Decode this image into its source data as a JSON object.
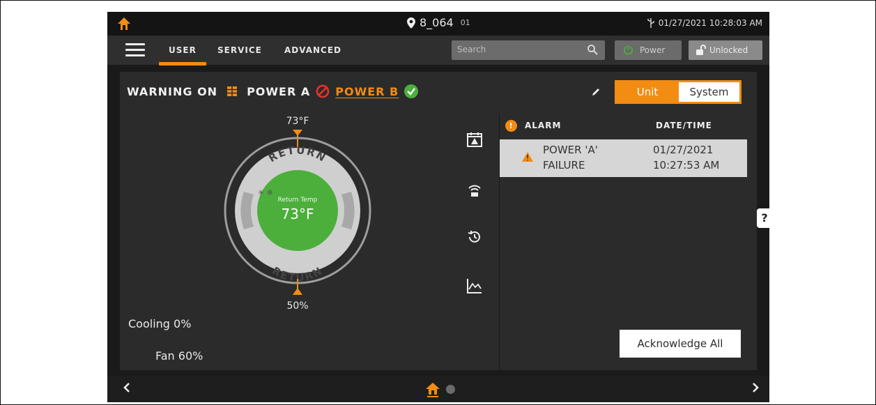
{
  "status": {
    "location": "8_064",
    "location_sub": "01",
    "datetime": "01/27/2021 10:28:03 AM"
  },
  "nav": {
    "tabs": [
      "USER",
      "SERVICE",
      "ADVANCED"
    ],
    "active_tab": "USER",
    "search_placeholder": "Search",
    "power_label": "Power",
    "lock_label": "Unlocked"
  },
  "status_line": {
    "warning_label": "WARNING ON",
    "power_a_label": "POWER A",
    "power_b_label": "POWER B"
  },
  "view_toggle": {
    "unit_label": "Unit",
    "system_label": "System",
    "selected": "Unit"
  },
  "gauge": {
    "setpoint_top": "73°F",
    "ring_top_label": "RETURN",
    "ring_bottom_label": "RETURN",
    "center_caption": "Return Temp",
    "center_value": "73°F",
    "setpoint_bottom": "50%"
  },
  "stats": {
    "cooling": "Cooling 0%",
    "fan": "Fan 60%"
  },
  "alarms": {
    "badge": "!",
    "header_alarm": "ALARM",
    "header_datetime": "DATE/TIME",
    "rows": [
      {
        "text_line1": "POWER 'A'",
        "text_line2": "FAILURE",
        "date": "01/27/2021",
        "time": "10:27:53 AM"
      }
    ],
    "acknowledge_label": "Acknowledge All"
  },
  "help_label": "?",
  "colors": {
    "accent": "#f28c13",
    "green": "#4caf3c",
    "panel": "#2b2b2b",
    "alert_red": "#e8332a"
  },
  "icons": [
    "home-icon",
    "location-pin-icon",
    "usb-icon",
    "menu-icon",
    "search-icon",
    "power-icon",
    "unlock-icon",
    "warning-grid-icon",
    "no-entry-icon",
    "check-icon",
    "edit-icon",
    "calendar-alarm-icon",
    "wireless-icon",
    "history-icon",
    "trend-chart-icon",
    "warning-triangle-icon",
    "chevron-left-icon",
    "chevron-right-icon"
  ]
}
